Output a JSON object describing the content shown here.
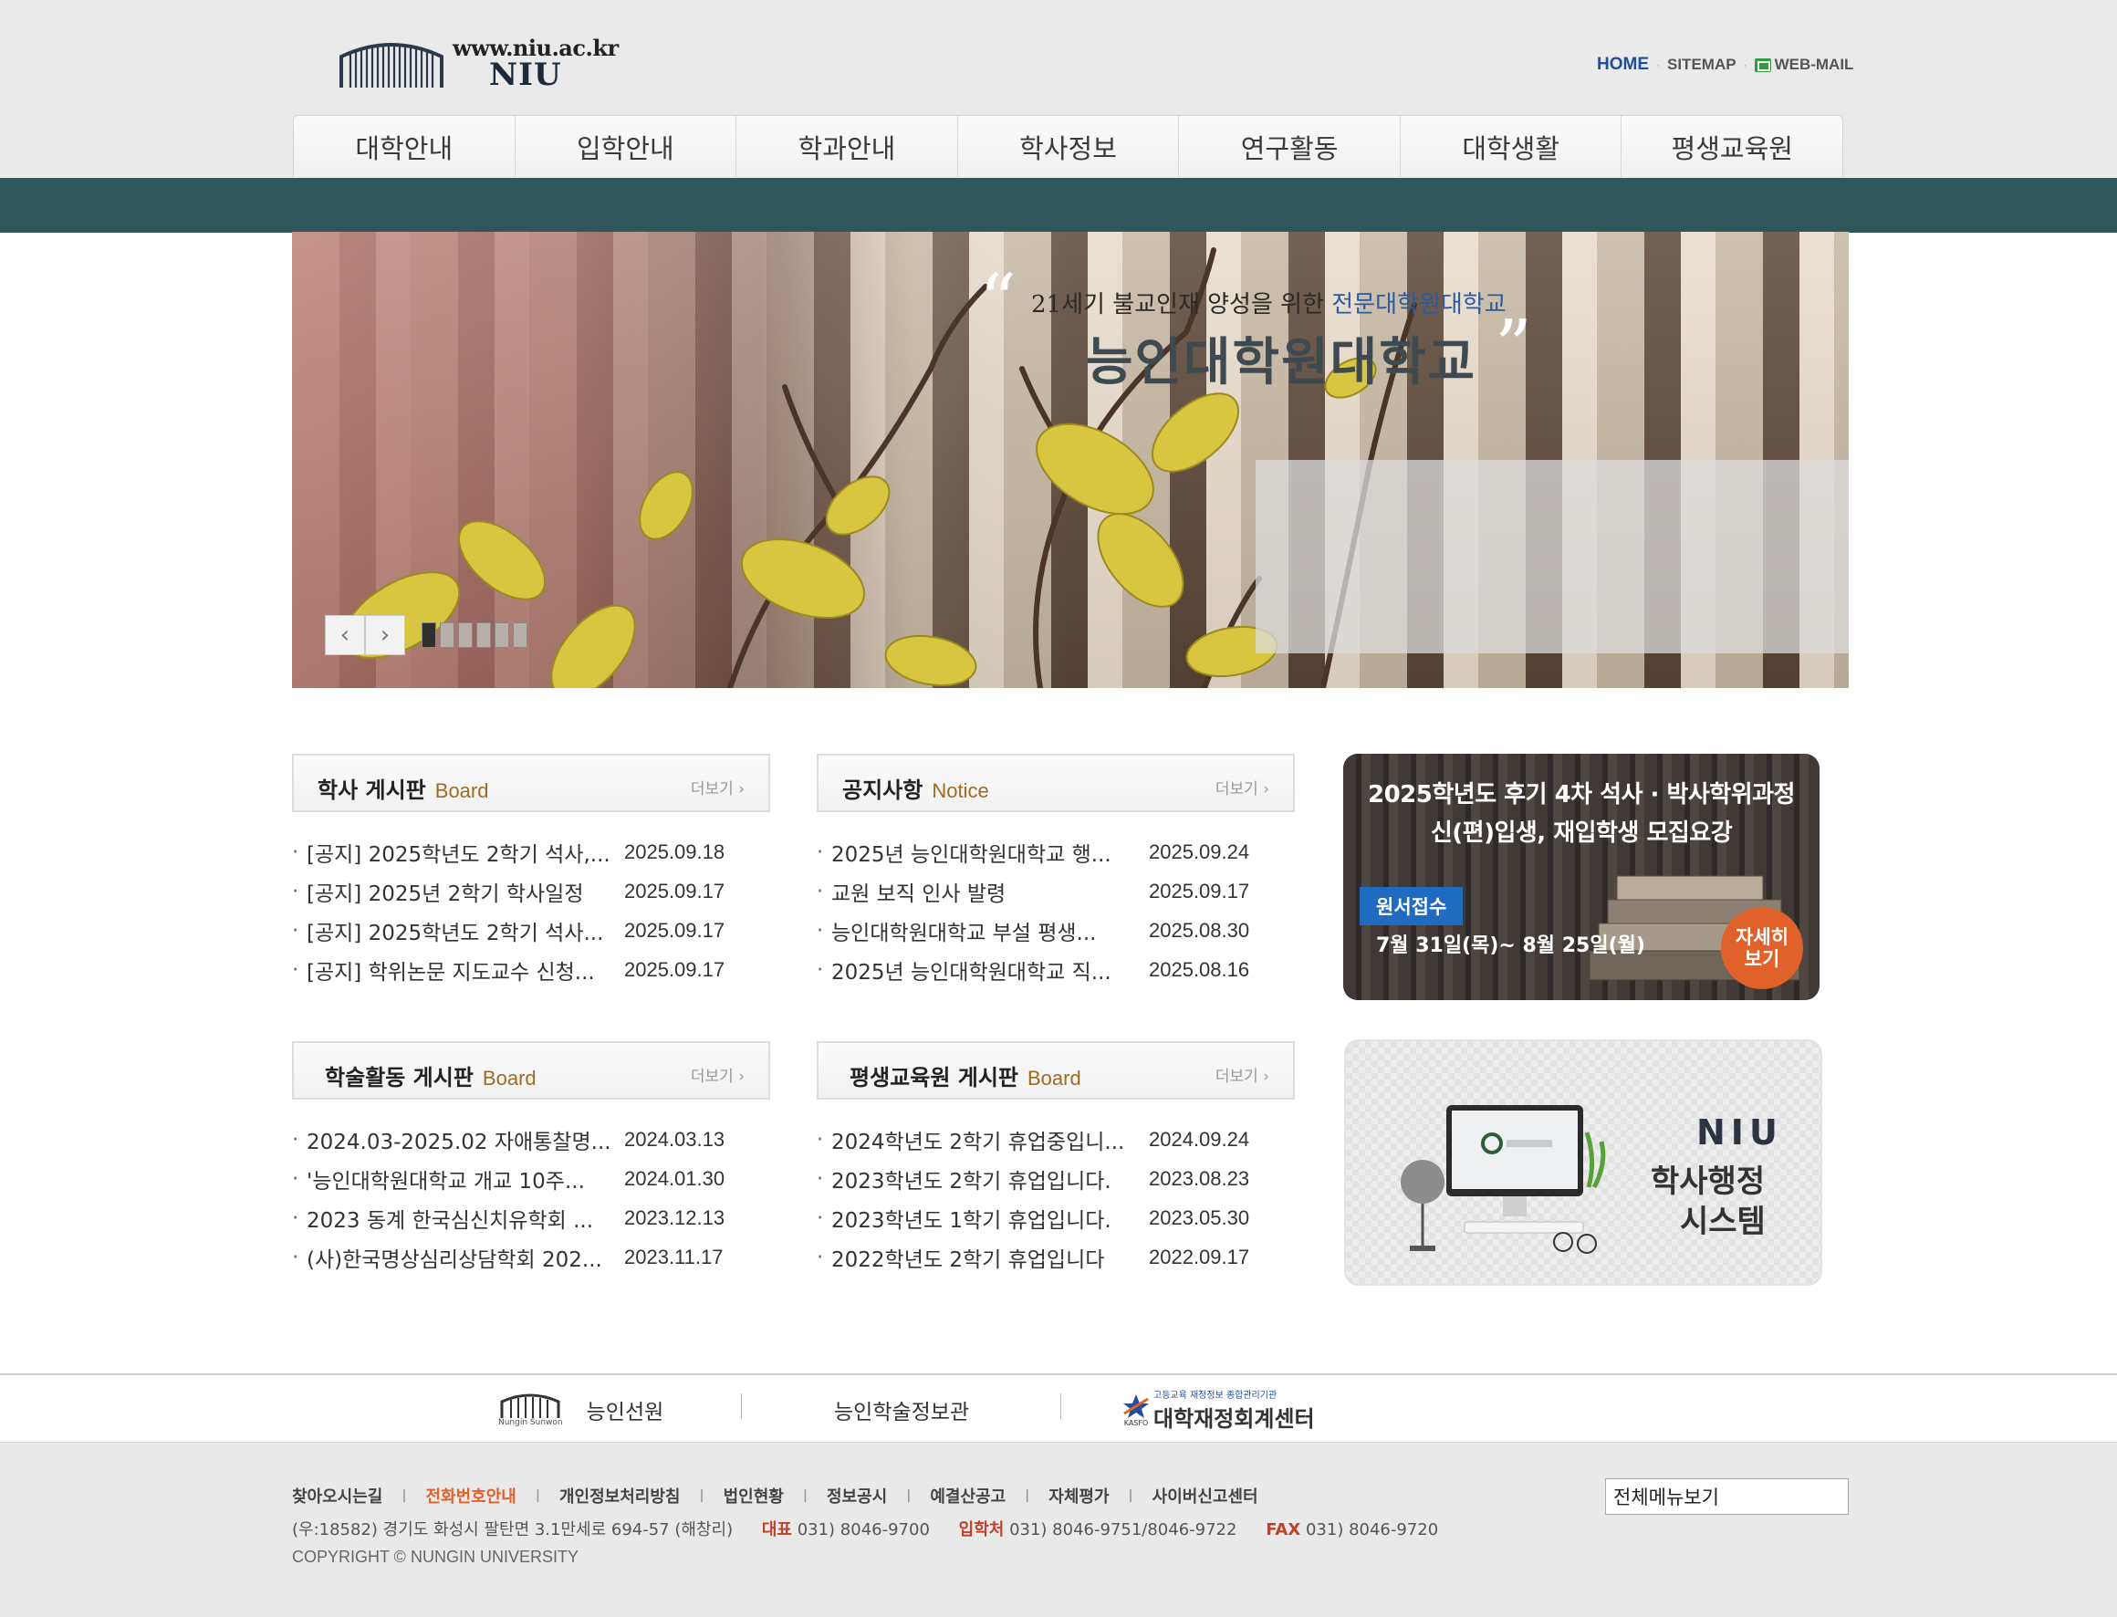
{
  "header": {
    "logo_url": "www.niu.ac.kr",
    "logo_name": "NIU",
    "util": {
      "home": "HOME",
      "sitemap": "SITEMAP",
      "webmail": "WEB-MAIL"
    },
    "nav": [
      "대학안내",
      "입학안내",
      "학과안내",
      "학사정보",
      "연구활동",
      "대학생활",
      "평생교육원"
    ]
  },
  "hero": {
    "subtitle_pre": "21세기 불교인재 양성을 위한 ",
    "subtitle_hl": "전문대학원대학교",
    "title": "능인대학원대학교",
    "prev": "‹",
    "next": "›",
    "slide_count": 6,
    "active_slide": 1
  },
  "boards": [
    {
      "title": "학사 게시판",
      "sub": "Board",
      "more": "더보기 ›",
      "items": [
        {
          "title": "[공지] 2025학년도 2학기 석사,...",
          "date": "2025.09.18"
        },
        {
          "title": "[공지] 2025년 2학기 학사일정",
          "date": "2025.09.17"
        },
        {
          "title": "[공지] 2025학년도 2학기 석사...",
          "date": "2025.09.17"
        },
        {
          "title": "[공지] 학위논문 지도교수 신청...",
          "date": "2025.09.17"
        }
      ]
    },
    {
      "title": "공지사항",
      "sub": "Notice",
      "more": "더보기 ›",
      "items": [
        {
          "title": "2025년 능인대학원대학교 행...",
          "date": "2025.09.24"
        },
        {
          "title": "교원 보직 인사 발령",
          "date": "2025.09.17"
        },
        {
          "title": "능인대학원대학교 부설 평생...",
          "date": "2025.08.30"
        },
        {
          "title": "2025년 능인대학원대학교 직...",
          "date": "2025.08.16"
        }
      ]
    },
    {
      "title": "학술활동 게시판",
      "sub": "Board",
      "more": "더보기 ›",
      "items": [
        {
          "title": "2024.03-2025.02 자애통찰명...",
          "date": "2024.03.13"
        },
        {
          "title": "'능인대학원대학교 개교 10주...",
          "date": "2024.01.30"
        },
        {
          "title": "2023 동계 한국심신치유학회 ...",
          "date": "2023.12.13"
        },
        {
          "title": "(사)한국명상심리상담학회 202...",
          "date": "2023.11.17"
        }
      ]
    },
    {
      "title": "평생교육원 게시판",
      "sub": "Board",
      "more": "더보기 ›",
      "items": [
        {
          "title": "2024학년도 2학기 휴업중입니...",
          "date": "2024.09.24"
        },
        {
          "title": "2023학년도 2학기 휴업입니다.",
          "date": "2023.08.23"
        },
        {
          "title": "2023학년도 1학기 휴업입니다.",
          "date": "2023.05.30"
        },
        {
          "title": "2022학년도 2학기 휴업입니다",
          "date": "2022.09.17"
        }
      ]
    }
  ],
  "admission": {
    "line1": "2025학년도 후기 4차 석사 · 박사학위과정",
    "line2": "신(편)입생, 재입학생 모집요강",
    "tag": "원서접수",
    "date": "7월 31일(목)~ 8월 25일(월)",
    "btn1": "자세히",
    "btn2": "보기"
  },
  "system": {
    "brand": "NIU",
    "line1": "학사행정",
    "line2": "시스템"
  },
  "family": {
    "sunwon_mark": "Nungin Sunwon",
    "sunwon": "능인선원",
    "library": "능인학술정보관",
    "kasfo_small": "고등교육 재정정보 종합관리기관",
    "kasfo": "대학재정회계센터",
    "kasfo_mark": "KASFO"
  },
  "footer": {
    "links": [
      "찾아오시는길",
      "전화번호안내",
      "개인정보처리방침",
      "법인현황",
      "정보공시",
      "예결산공고",
      "자체평가",
      "사이버신고센터"
    ],
    "address": "(우:18582) 경기도 화성시 팔탄면 3.1만세로 694-57 (해창리)",
    "tel_label": "대표",
    "tel": "031) 8046-9700",
    "admission_label": "입학처",
    "admission_tel": "031) 8046-9751/8046-9722",
    "fax_label": "FAX",
    "fax": "031) 8046-9720",
    "copyright": "COPYRIGHT © NUNGIN UNIVERSITY",
    "menu_select": "전체메뉴보기"
  },
  "colors": {
    "teal_band": "#2f5658",
    "accent_orange": "#e0612a",
    "accent_blue": "#1f4e9b",
    "board_sub": "#a06a22"
  }
}
